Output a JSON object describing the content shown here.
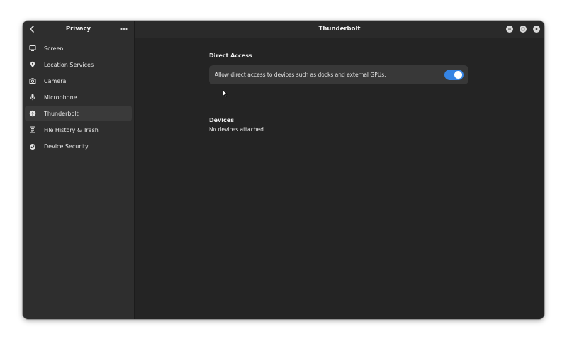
{
  "sidebar": {
    "title": "Privacy",
    "back_icon": "chevron-left-icon",
    "menu_icon": "more-horizontal-icon",
    "items": [
      {
        "label": "Screen",
        "icon": "monitor-icon"
      },
      {
        "label": "Location Services",
        "icon": "location-pin-icon"
      },
      {
        "label": "Camera",
        "icon": "camera-icon"
      },
      {
        "label": "Microphone",
        "icon": "microphone-icon"
      },
      {
        "label": "Thunderbolt",
        "icon": "thunderbolt-icon",
        "selected": true
      },
      {
        "label": "File History & Trash",
        "icon": "file-history-icon"
      },
      {
        "label": "Device Security",
        "icon": "shield-icon"
      }
    ]
  },
  "header": {
    "title": "Thunderbolt",
    "window_controls": [
      "minimize-icon",
      "maximize-icon",
      "close-icon"
    ]
  },
  "direct_access": {
    "title": "Direct Access",
    "toggle_label": "Allow direct access to devices such as docks and external GPUs.",
    "toggle_on": true
  },
  "devices": {
    "title": "Devices",
    "empty_text": "No devices attached"
  },
  "colors": {
    "accent": "#3584e4",
    "window_bg": "#242424",
    "sidebar_bg": "#2e2e2e",
    "row_bg": "#383838",
    "selected_bg": "#3a3a3a"
  }
}
